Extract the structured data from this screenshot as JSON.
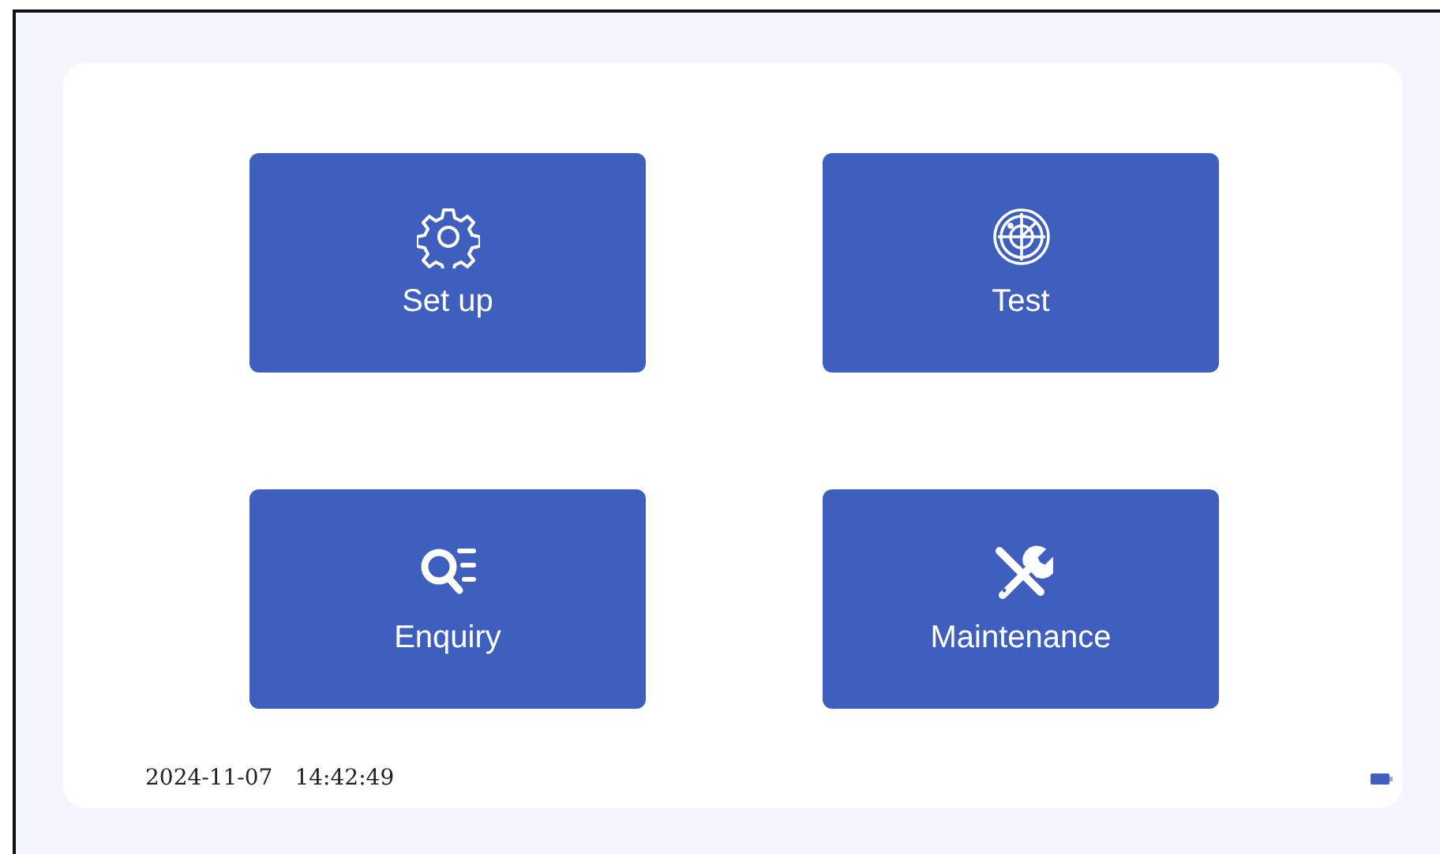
{
  "tiles": [
    {
      "kind": "gear",
      "label": "Set up"
    },
    {
      "kind": "radar",
      "label": "Test"
    },
    {
      "kind": "search-list",
      "label": "Enquiry"
    },
    {
      "kind": "tools",
      "label": "Maintenance"
    }
  ],
  "status_bar": {
    "date": "2024-11-07",
    "time": "14:42:49"
  }
}
